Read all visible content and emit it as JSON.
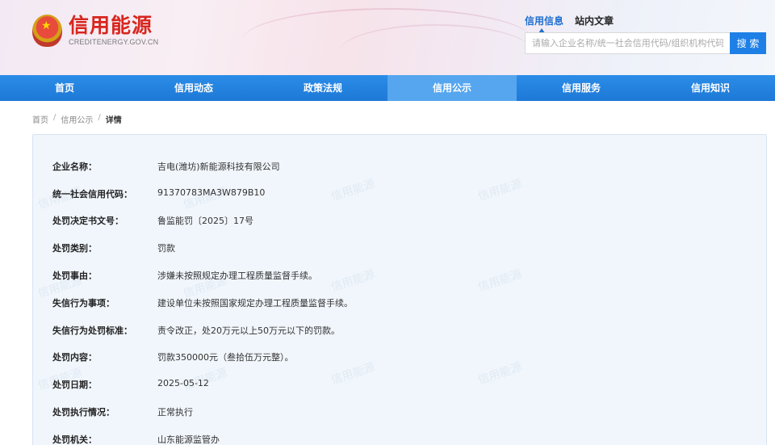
{
  "header": {
    "logo_cn": "信用能源",
    "logo_en": "CREDITENERGY.GOV.CN",
    "search_tabs": [
      {
        "label": "信用信息",
        "active": true
      },
      {
        "label": "站内文章",
        "active": false
      }
    ],
    "search_placeholder": "请输入企业名称/统一社会信用代码/组织机构代码",
    "search_button": "搜 索"
  },
  "nav": {
    "items": [
      {
        "label": "首页",
        "active": false
      },
      {
        "label": "信用动态",
        "active": false
      },
      {
        "label": "政策法规",
        "active": false
      },
      {
        "label": "信用公示",
        "active": true
      },
      {
        "label": "信用服务",
        "active": false
      },
      {
        "label": "信用知识",
        "active": false
      }
    ]
  },
  "breadcrumb": {
    "items": [
      "首页",
      "信用公示",
      "详情"
    ],
    "separator": "/"
  },
  "watermark_text": "信用能源",
  "details": [
    {
      "label": "企业名称：",
      "value": "吉电(潍坊)新能源科技有限公司"
    },
    {
      "label": "统一社会信用代码：",
      "value": "91370783MA3W879B10"
    },
    {
      "label": "处罚决定书文号：",
      "value": "鲁监能罚〔2025〕17号"
    },
    {
      "label": "处罚类别：",
      "value": "罚款"
    },
    {
      "label": "处罚事由：",
      "value": "涉嫌未按照规定办理工程质量监督手续。"
    },
    {
      "label": "失信行为事项：",
      "value": "建设单位未按照国家规定办理工程质量监督手续。"
    },
    {
      "label": "失信行为处罚标准：",
      "value": "责令改正，处20万元以上50万元以下的罚款。"
    },
    {
      "label": "处罚内容：",
      "value": "罚款350000元（叁拾伍万元整）。"
    },
    {
      "label": "处罚日期：",
      "value": "2025-05-12"
    },
    {
      "label": "处罚执行情况：",
      "value": "正常执行"
    },
    {
      "label": "处罚机关：",
      "value": "山东能源监管办"
    }
  ],
  "colors": {
    "brand_red": "#d7261e",
    "nav_blue": "#1e78d6",
    "nav_active": "#55a6ee",
    "accent_blue": "#1f6fcf"
  }
}
